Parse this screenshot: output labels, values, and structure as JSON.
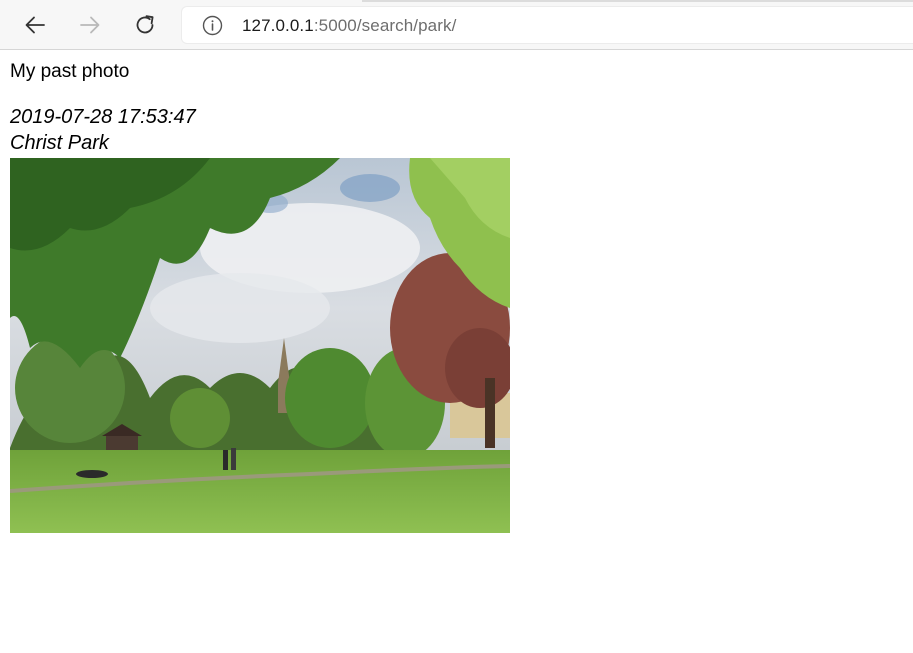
{
  "browser": {
    "url_host": "127.0.0.1",
    "url_path": ":5000/search/park/",
    "back_icon": "arrow-left-icon",
    "forward_icon": "arrow-right-icon",
    "reload_icon": "reload-icon",
    "site_info_icon": "info-icon"
  },
  "page": {
    "heading": "My past photo",
    "photo": {
      "timestamp": "2019-07-28 17:53:47",
      "location": "Christ Park"
    }
  },
  "colors": {
    "sky": "#cfd6de",
    "grass": "#7fb347",
    "foliage": "#3f7a2a",
    "copper_beech": "#8a4b3f"
  }
}
